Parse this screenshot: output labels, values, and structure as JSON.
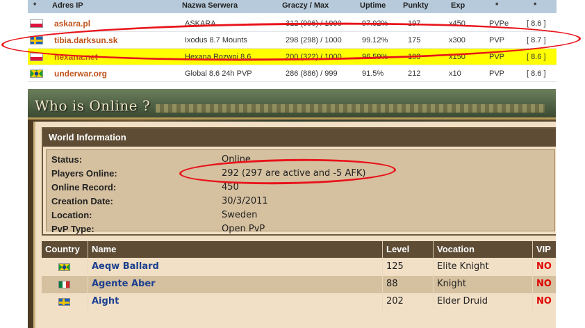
{
  "server_list": {
    "headers": [
      "*",
      "Adres IP",
      "Nazwa Serwera",
      "Graczy / Max",
      "Uptime",
      "Punkty",
      "Exp",
      "*",
      "*"
    ],
    "rows": [
      {
        "flag": "poland-flag",
        "address": "askara.pl",
        "name": "ASKARA",
        "players": "312 (996) / 1000",
        "uptime": "97.92%",
        "points": "197",
        "exp": "x450",
        "type": "PVPe",
        "version": "[ 8.6 ]",
        "highlight": false
      },
      {
        "flag": "sweden-flag",
        "address": "tibia.darksun.sk",
        "name": "Ixodus 8.7 Mounts",
        "players": "298 (298) / 1000",
        "uptime": "99.12%",
        "points": "175",
        "exp": "x300",
        "type": "PVP",
        "version": "[ 8.7 ]",
        "highlight": false
      },
      {
        "flag": "poland-flag",
        "address": "hexana.net",
        "name": "Hexana Rozwoj 8.6",
        "players": "200 (322) / 1000",
        "uptime": "96.59%",
        "points": "193",
        "exp": "x150",
        "type": "PVP",
        "version": "[ 8.6 ]",
        "highlight": true
      },
      {
        "flag": "brazil-flag",
        "address": "underwar.org",
        "name": "Global 8.6 24h PVP",
        "players": "286 (886) / 999",
        "uptime": "91.5%",
        "points": "212",
        "exp": "x10",
        "type": "PVP",
        "version": "[ 8.6 ]",
        "highlight": false
      }
    ]
  },
  "page": {
    "title": "Who is Online ?"
  },
  "world_info": {
    "caption": "World Information",
    "fields": [
      {
        "label": "Status:",
        "value": "Online"
      },
      {
        "label": "Players Online:",
        "value": "292 (297 are active and -5 AFK)"
      },
      {
        "label": "Online Record:",
        "value": "450"
      },
      {
        "label": "Creation Date:",
        "value": "30/3/2011"
      },
      {
        "label": "Location:",
        "value": "Sweden"
      },
      {
        "label": "PvP Type:",
        "value": "Open PvP"
      }
    ]
  },
  "players_table": {
    "headers": [
      "Country",
      "Name",
      "Level",
      "Vocation",
      "VIP"
    ],
    "rows": [
      {
        "flag": "brazil-flag",
        "name": "Aeqw Ballard",
        "level": "125",
        "vocation": "Elite Knight",
        "vip": "NO"
      },
      {
        "flag": "mexico-flag",
        "name": "Agente Aber",
        "level": "88",
        "vocation": "Knight",
        "vip": "NO"
      },
      {
        "flag": "sweden-flag",
        "name": "Aight",
        "level": "202",
        "vocation": "Elder Druid",
        "vip": "NO"
      }
    ]
  },
  "colors": {
    "server_address": "#c0531a",
    "highlight_row": "#ffff00",
    "panel_header": "#5e4c35",
    "player_name": "#1c3f8f",
    "vip_no": "#e00000",
    "annotation": "#e8141b"
  }
}
